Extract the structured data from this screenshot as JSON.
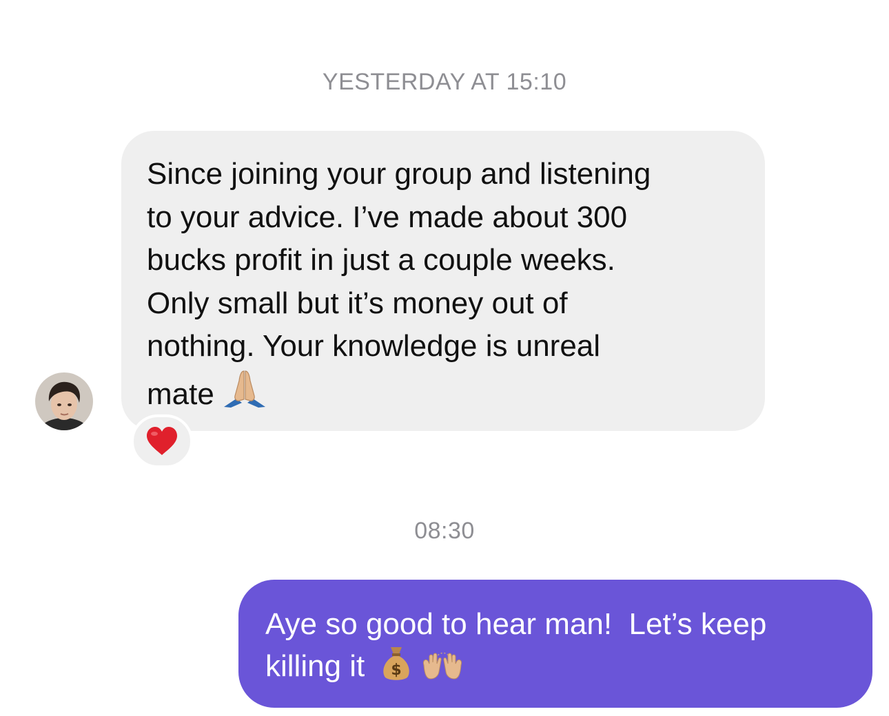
{
  "conversation": {
    "timestamps": [
      "YESTERDAY AT 15:10",
      "08:30"
    ],
    "incoming": {
      "lines": [
        "Since joining your group and listening",
        "to your advice. I’ve made about 300",
        "bucks profit in just a couple weeks.",
        "Only small but it’s money out of",
        "nothing. Your knowledge is unreal",
        "mate"
      ],
      "trailing_emoji": "folded-hands-emoji",
      "reaction": "heart-emoji"
    },
    "outgoing": {
      "lines": [
        "Aye so good to hear man!  Let’s keep",
        "killing it"
      ],
      "trailing_emojis": [
        "money-bag-emoji",
        "raising-hands-emoji"
      ]
    }
  },
  "colors": {
    "incoming_bubble": "#efefef",
    "outgoing_bubble": "#6a55d8",
    "timestamp": "#8e8e93",
    "heart": "#e0202c"
  }
}
